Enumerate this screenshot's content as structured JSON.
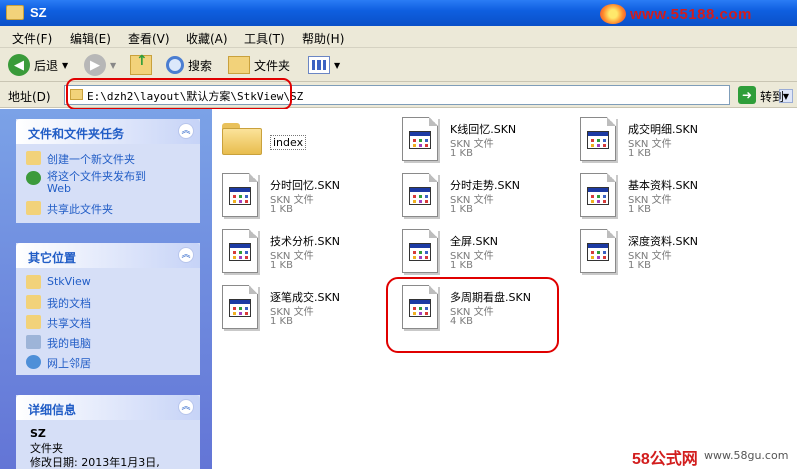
{
  "window": {
    "title": "SZ"
  },
  "watermark_top": "www.55188.com",
  "watermark_bottom": {
    "brand": "58公式网",
    "url": "www.58gu.com"
  },
  "menu": [
    "文件(F)",
    "编辑(E)",
    "查看(V)",
    "收藏(A)",
    "工具(T)",
    "帮助(H)"
  ],
  "toolbar": {
    "back": "后退",
    "search": "搜索",
    "folders": "文件夹"
  },
  "address": {
    "label": "地址(D)",
    "value": "E:\\dzh2\\layout\\默认方案\\StkView\\SZ",
    "go": "转到"
  },
  "tasks": {
    "title": "文件和文件夹任务",
    "items": [
      "创建一个新文件夹",
      "将这个文件夹发布到",
      "Web",
      "共享此文件夹"
    ]
  },
  "places": {
    "title": "其它位置",
    "items": [
      "StkView",
      "我的文档",
      "共享文档",
      "我的电脑",
      "网上邻居"
    ]
  },
  "details": {
    "title": "详细信息",
    "name": "SZ",
    "type": "文件夹",
    "modified": "修改日期: 2013年1月3日,"
  },
  "files": [
    {
      "name": "index",
      "kind": "folder"
    },
    {
      "name": "K线回忆.SKN",
      "type": "SKN 文件",
      "size": "1 KB"
    },
    {
      "name": "成交明细.SKN",
      "type": "SKN 文件",
      "size": "1 KB"
    },
    {
      "name": "分时回忆.SKN",
      "type": "SKN 文件",
      "size": "1 KB"
    },
    {
      "name": "分时走势.SKN",
      "type": "SKN 文件",
      "size": "1 KB"
    },
    {
      "name": "基本资料.SKN",
      "type": "SKN 文件",
      "size": "1 KB"
    },
    {
      "name": "技术分析.SKN",
      "type": "SKN 文件",
      "size": "1 KB"
    },
    {
      "name": "全屏.SKN",
      "type": "SKN 文件",
      "size": "1 KB"
    },
    {
      "name": "深度资料.SKN",
      "type": "SKN 文件",
      "size": "1 KB"
    },
    {
      "name": "逐笔成交.SKN",
      "type": "SKN 文件",
      "size": "1 KB"
    },
    {
      "name": "多周期看盘.SKN",
      "type": "SKN 文件",
      "size": "4 KB"
    }
  ]
}
